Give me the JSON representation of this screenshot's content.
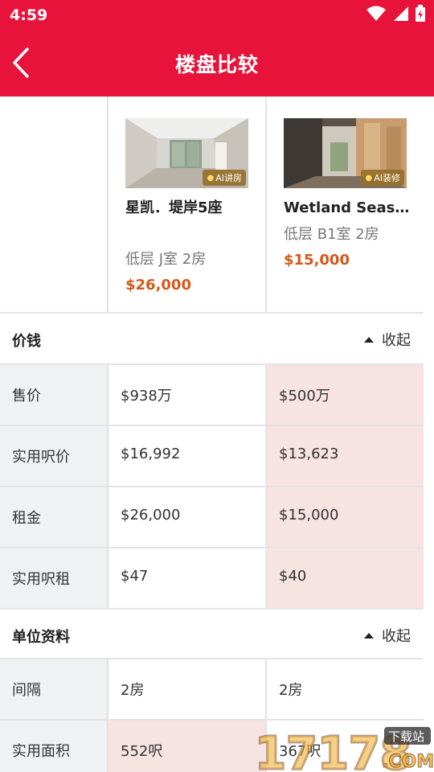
{
  "status": {
    "time": "4:59"
  },
  "header": {
    "title": "楼盘比较"
  },
  "properties": [
    {
      "name": "星凯．堤岸5座",
      "unit": "低层 J室 2房",
      "price": "$26,000",
      "badge": "AI讲房"
    },
    {
      "name": "Wetland Seaso...",
      "unit": "低层 B1室 2房",
      "price": "$15,000",
      "badge": "AI装修"
    }
  ],
  "sections": [
    {
      "title": "价钱",
      "collapse_label": "收起",
      "rows": [
        {
          "label": "售价",
          "values": [
            "$938万",
            "$500万"
          ],
          "highlight": 1
        },
        {
          "label": "实用呎价",
          "values": [
            "$16,992",
            "$13,623"
          ],
          "highlight": 1
        },
        {
          "label": "租金",
          "values": [
            "$26,000",
            "$15,000"
          ],
          "highlight": 1
        },
        {
          "label": "实用呎租",
          "values": [
            "$47",
            "$40"
          ],
          "highlight": 1
        }
      ]
    },
    {
      "title": "单位资料",
      "collapse_label": "收起",
      "rows": [
        {
          "label": "间隔",
          "values": [
            "2房",
            "2房"
          ],
          "highlight": -1
        },
        {
          "label": "实用面积",
          "values": [
            "552呎",
            "367呎"
          ],
          "highlight": 0
        }
      ]
    }
  ],
  "watermark": {
    "text": "17178",
    "sub": "下载站",
    "suffix": ".COM"
  },
  "colors": {
    "brand": "#e8133a",
    "price": "#d4581c",
    "highlight": "#f8e3e3",
    "label_bg": "#eef2f3"
  }
}
